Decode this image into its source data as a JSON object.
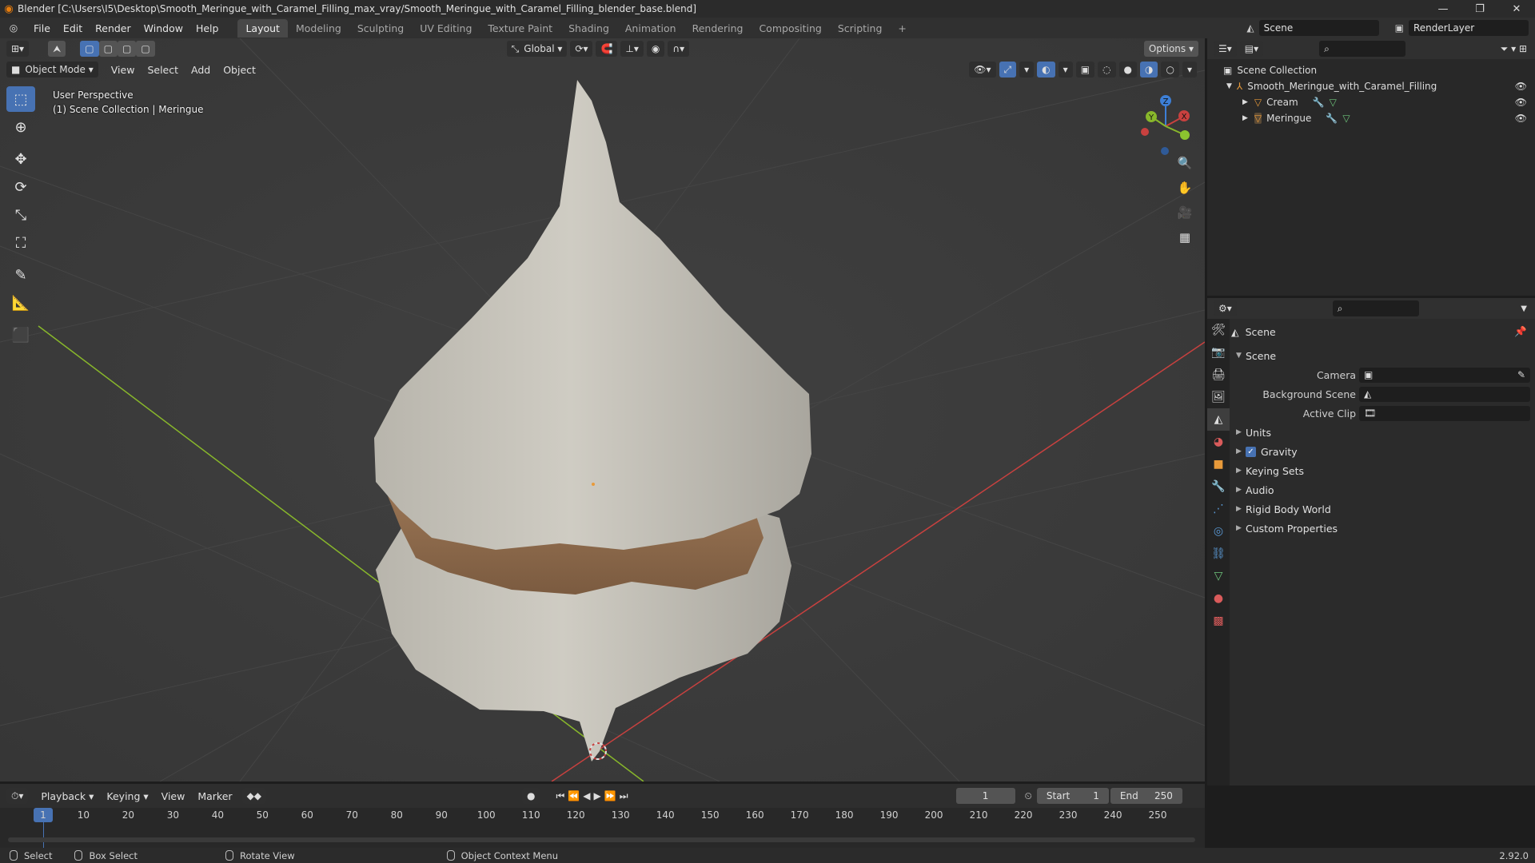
{
  "window": {
    "title": "Blender [C:\\Users\\I5\\Desktop\\Smooth_Meringue_with_Caramel_Filling_max_vray/Smooth_Meringue_with_Caramel_Filling_blender_base.blend]",
    "controls": [
      "—",
      "❐",
      "✕"
    ]
  },
  "menubar": {
    "menus": [
      "File",
      "Edit",
      "Render",
      "Window",
      "Help"
    ],
    "workspaces": [
      "Layout",
      "Modeling",
      "Sculpting",
      "UV Editing",
      "Texture Paint",
      "Shading",
      "Animation",
      "Rendering",
      "Compositing",
      "Scripting"
    ],
    "active_workspace": "Layout",
    "add_tab": "+",
    "scene_name": "Scene",
    "view_layer": "RenderLayer"
  },
  "viewport": {
    "header": {
      "transform_orientation": "Global",
      "options_label": "Options",
      "mode": "Object Mode",
      "menus": [
        "View",
        "Select",
        "Add",
        "Object"
      ]
    },
    "overlay_text": {
      "perspective": "User Perspective",
      "context": "(1) Scene Collection | Meringue"
    },
    "gizmo_axes": {
      "x": "X",
      "y": "Y",
      "z": "Z"
    },
    "colors": {
      "background": "#3b3b3b",
      "x_axis": "#c8413f",
      "y_axis": "#88b72b",
      "meringue": "#c9c6bd",
      "caramel": "#8a6a4c"
    }
  },
  "outliner": {
    "root": "Scene Collection",
    "collection": "Smooth_Meringue_with_Caramel_Filling",
    "objects": [
      "Cream",
      "Meringue"
    ]
  },
  "properties": {
    "context_title": "Scene",
    "panel_title": "Scene",
    "fields": [
      {
        "label": "Camera",
        "value": ""
      },
      {
        "label": "Background Scene",
        "value": ""
      },
      {
        "label": "Active Clip",
        "value": ""
      }
    ],
    "panels": [
      "Units",
      "Gravity",
      "Keying Sets",
      "Audio",
      "Rigid Body World",
      "Custom Properties"
    ],
    "gravity_checked": true
  },
  "timeline": {
    "menus": [
      "Playback",
      "Keying",
      "View",
      "Marker"
    ],
    "current_frame": "1",
    "start_label": "Start",
    "start_value": "1",
    "end_label": "End",
    "end_value": "250",
    "ruler_ticks": [
      "1",
      "10",
      "20",
      "30",
      "40",
      "50",
      "60",
      "70",
      "80",
      "90",
      "100",
      "110",
      "120",
      "130",
      "140",
      "150",
      "160",
      "170",
      "180",
      "190",
      "200",
      "210",
      "220",
      "230",
      "240",
      "250"
    ]
  },
  "statusbar": {
    "select": "Select",
    "box_select": "Box Select",
    "rotate_view": "Rotate View",
    "context_menu": "Object Context Menu",
    "version": "2.92.0"
  }
}
